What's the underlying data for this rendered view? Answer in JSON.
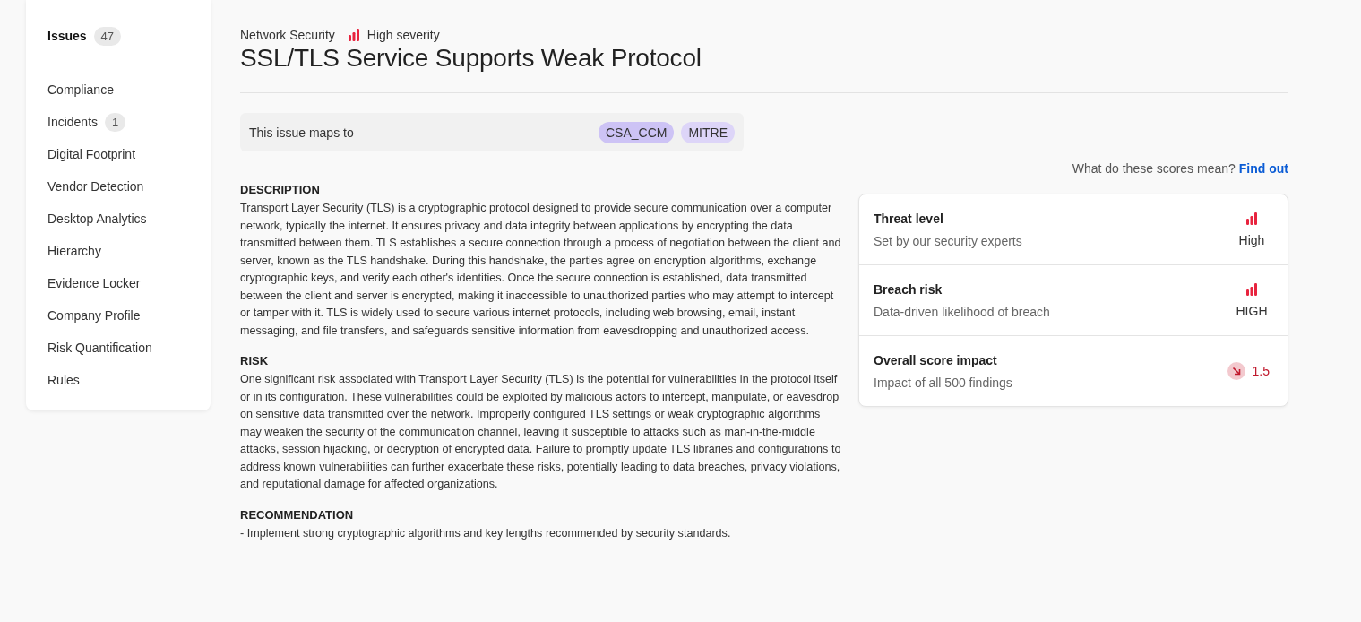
{
  "sidebar": {
    "items": [
      {
        "label": "Issues",
        "count": "47",
        "selected": true
      },
      {
        "label": "Compliance",
        "selected": false
      },
      {
        "label": "Incidents",
        "count": "1",
        "selected": false
      },
      {
        "label": "Digital Footprint",
        "selected": false
      },
      {
        "label": "Vendor Detection",
        "selected": false
      },
      {
        "label": "Desktop Analytics",
        "selected": false
      },
      {
        "label": "Hierarchy",
        "selected": false
      },
      {
        "label": "Evidence Locker",
        "selected": false
      },
      {
        "label": "Company Profile",
        "selected": false
      },
      {
        "label": "Risk Quantification",
        "selected": false
      },
      {
        "label": "Rules",
        "selected": false
      }
    ]
  },
  "issue": {
    "category": "Network Security",
    "severity": "High severity",
    "title": "SSL/TLS Service Supports Weak Protocol"
  },
  "mapping": {
    "label": "This issue maps to",
    "tags": [
      {
        "label": "CSA_CCM",
        "color": "#cdc3f5"
      },
      {
        "label": "MITRE",
        "color": "#ddd5f8"
      }
    ]
  },
  "sections": [
    {
      "heading": "DESCRIPTION",
      "text": "Transport Layer Security (TLS) is a cryptographic protocol designed to provide secure communication over a computer network, typically the internet. It ensures privacy and data integrity between applications by encrypting the data transmitted between them. TLS establishes a secure connection through a process of negotiation between the client and server, known as the TLS handshake. During this handshake, the parties agree on encryption algorithms, exchange cryptographic keys, and verify each other's identities. Once the secure connection is established, data transmitted between the client and server is encrypted, making it inaccessible to unauthorized parties who may attempt to intercept or tamper with it. TLS is widely used to secure various internet protocols, including web browsing, email, instant messaging, and file transfers, and safeguards sensitive information from eavesdropping and unauthorized access."
    },
    {
      "heading": "RISK",
      "text": "One significant risk associated with Transport Layer Security (TLS) is the potential for vulnerabilities in the protocol itself or in its configuration. These vulnerabilities could be exploited by malicious actors to intercept, manipulate, or eavesdrop on sensitive data transmitted over the network. Improperly configured TLS settings or weak cryptographic algorithms may weaken the security of the communication channel, leaving it susceptible to attacks such as man-in-the-middle attacks, session hijacking, or decryption of encrypted data. Failure to promptly update TLS libraries and configurations to address known vulnerabilities can further exacerbate these risks, potentially leading to data breaches, privacy violations, and reputational damage for affected organizations."
    },
    {
      "heading": "RECOMMENDATION",
      "text": "- Implement strong cryptographic algorithms and key lengths recommended by security standards."
    }
  ],
  "scores": {
    "question": "What do these scores mean?",
    "link": "Find out",
    "rows": [
      {
        "kind": "bars",
        "title": "Threat level",
        "subtitle": "Set by our security experts",
        "value": "High"
      },
      {
        "kind": "bars",
        "title": "Breach risk",
        "subtitle": "Data-driven likelihood of breach",
        "value": "HIGH"
      },
      {
        "kind": "impact",
        "title": "Overall score impact",
        "subtitle": "Impact of all 500 findings",
        "value": "1.5"
      }
    ]
  }
}
